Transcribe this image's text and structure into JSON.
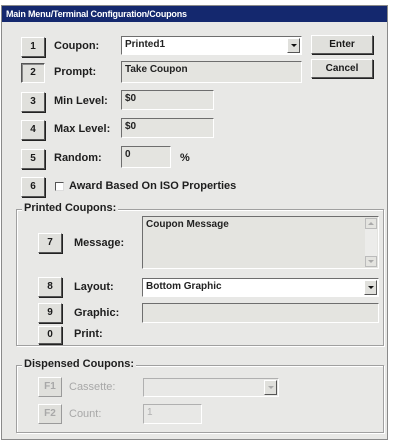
{
  "window": {
    "title": "Main Menu/Terminal Configuration/Coupons"
  },
  "buttons": {
    "enter": "Enter",
    "cancel": "Cancel"
  },
  "coupon": {
    "key": "1",
    "label": "Coupon:",
    "value": "Printed1"
  },
  "prompt": {
    "key": "2",
    "label": "Prompt:",
    "value": "Take Coupon"
  },
  "min_level": {
    "key": "3",
    "label": "Min Level:",
    "value": "$0"
  },
  "max_level": {
    "key": "4",
    "label": "Max Level:",
    "value": "$0"
  },
  "random": {
    "key": "5",
    "label": "Random:",
    "value": "0",
    "unit": "%"
  },
  "award": {
    "key": "6",
    "label": "Award Based On ISO Properties",
    "checked": false
  },
  "printed": {
    "title": "Printed Coupons:",
    "message": {
      "key": "7",
      "label": "Message:",
      "value": "Coupon Message"
    },
    "layout": {
      "key": "8",
      "label": "Layout:",
      "value": "Bottom Graphic"
    },
    "graphic": {
      "key": "9",
      "label": "Graphic:",
      "value": ""
    },
    "print": {
      "key": "0",
      "label": "Print:"
    }
  },
  "dispensed": {
    "title": "Dispensed Coupons:",
    "cassette": {
      "key": "F1",
      "label": "Cassette:",
      "value": ""
    },
    "count": {
      "key": "F2",
      "label": "Count:",
      "value": "1"
    }
  }
}
